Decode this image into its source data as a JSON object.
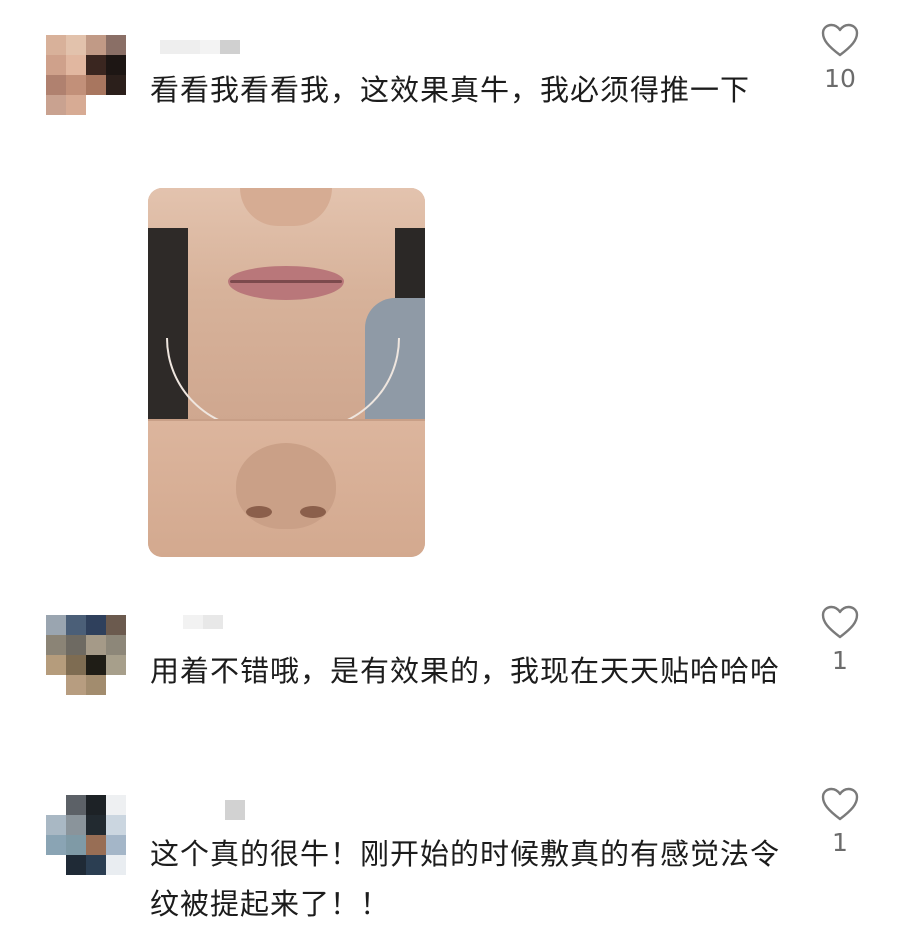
{
  "comments": [
    {
      "text": "看看我看看我，这效果真牛，我必须得推一下",
      "likes": "10",
      "avatar_colors": [
        "#d8b19a",
        "#e2c2ac",
        "#c19a86",
        "#8a6f66",
        "#cfa18b",
        "#e1b7a0",
        "#3a2620",
        "#1d1614",
        "#b0816f",
        "#c29079",
        "#a8765f",
        "#2b1f1b",
        "#c9a290",
        "#d7ab94",
        "#ffffff",
        "#ffffff"
      ],
      "name_colors": [
        "#eeeeee",
        "#f3f3f3",
        "#d0d0d0"
      ],
      "has_image": true,
      "icons": {
        "like": "heart-outline-icon"
      }
    },
    {
      "text": "用着不错哦，是有效果的，我现在天天贴哈哈哈",
      "likes": "1",
      "avatar_colors": [
        "#9aa5b0",
        "#4b5f78",
        "#2f405c",
        "#6b5a4e",
        "#8b8476",
        "#6e6a62",
        "#a59a88",
        "#8d8779",
        "#b59c7c",
        "#7e6c52",
        "#1f1d16",
        "#a79f8b",
        "#ffffff",
        "#b79d80",
        "#a28c6e",
        "#ffffff"
      ],
      "name_colors": [
        "#f2f2f2",
        "#e8e8e8"
      ],
      "has_image": false,
      "icons": {
        "like": "heart-outline-icon"
      }
    },
    {
      "text": "这个真的很牛！刚开始的时候敷真的有感觉法令纹被提起来了！！",
      "likes": "1",
      "avatar_colors": [
        "#ffffff",
        "#5c6167",
        "#1d2226",
        "#eef0f2",
        "#a9b8c4",
        "#8a949b",
        "#222a30",
        "#cbd6e0",
        "#8aa4b4",
        "#7f9aa6",
        "#986e55",
        "#a4b6c8",
        "#ffffff",
        "#1f2a36",
        "#2b3e52",
        "#e9edf1"
      ],
      "name_colors": [
        "#ffffff",
        "#d2d2d2"
      ],
      "has_image": false,
      "icons": {
        "like": "heart-outline-icon"
      }
    }
  ]
}
